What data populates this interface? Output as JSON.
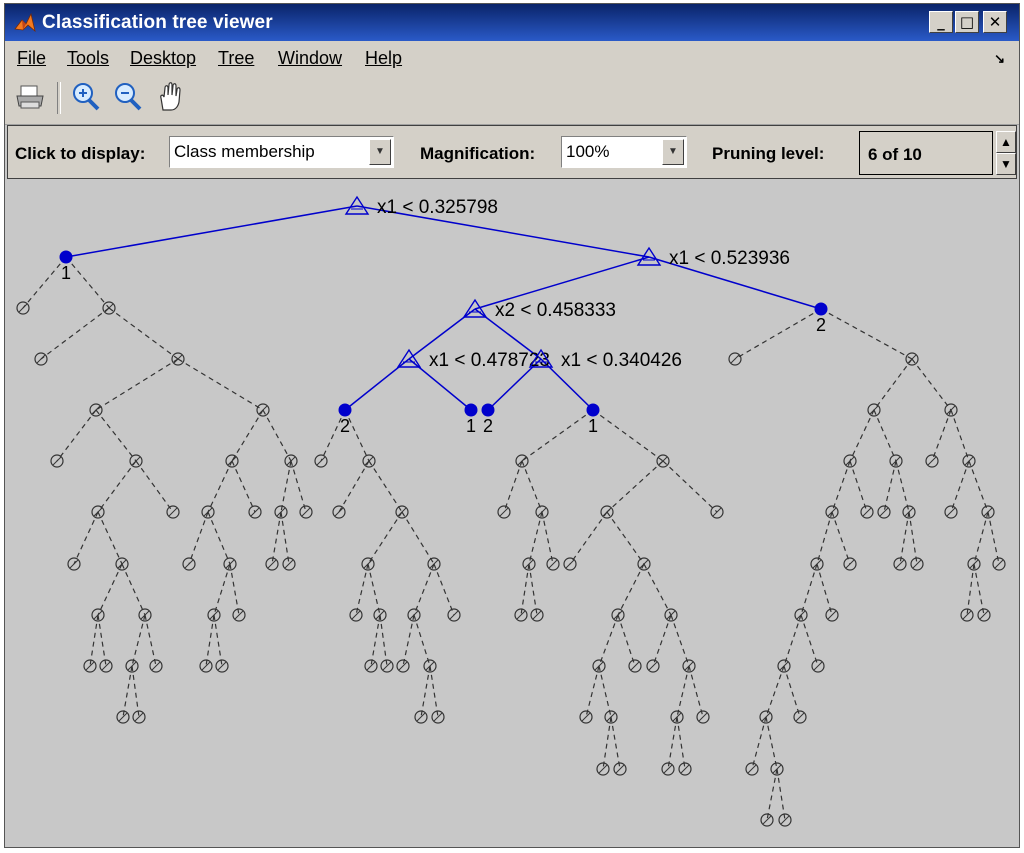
{
  "window": {
    "title": "Classification tree viewer"
  },
  "menubar": {
    "items": [
      "File",
      "Tools",
      "Desktop",
      "Tree",
      "Window",
      "Help"
    ]
  },
  "toolbar": {
    "tools": [
      "printer-icon",
      "zoom-in-icon",
      "zoom-out-icon",
      "pan-hand-icon"
    ]
  },
  "controls": {
    "display_label": "Click to display:",
    "display_value": "Class membership",
    "magnification_label": "Magnification:",
    "magnification_value": "100%",
    "pruning_label": "Pruning level:",
    "pruning_value": "6 of 10"
  },
  "tree": {
    "split_labels": [
      "x1 < 0.325798",
      "x1 < 0.523936",
      "x2 < 0.458333",
      "x1 < 0.478723",
      "x1 < 0.340426"
    ],
    "class_labels": [
      "1",
      "2",
      "2",
      "1",
      "2",
      "1"
    ]
  },
  "colors": {
    "active": "#0000cc",
    "pruned": "#333333",
    "background": "#c8c8c8"
  }
}
